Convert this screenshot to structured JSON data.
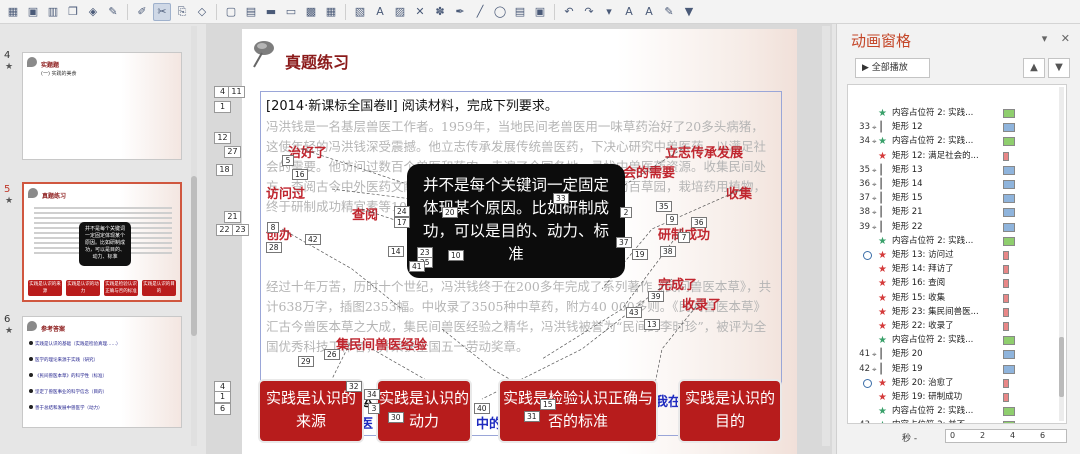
{
  "toolbar": {
    "icons": [
      "layout-icon",
      "picture-icon",
      "chart-icon",
      "group-icon",
      "cube-icon",
      "pin-icon",
      "brush-icon",
      "scissors-icon",
      "copy-icon",
      "shapes-icon",
      "new-icon",
      "open-icon",
      "folder-icon",
      "save-icon",
      "print-icon",
      "table-icon",
      "grid-icon",
      "text-icon",
      "image-icon",
      "erase-icon",
      "symbol-icon",
      "pen-icon",
      "line-icon",
      "shape-icon",
      "layout2-icon",
      "picture2-icon",
      "undo-icon",
      "redo-icon",
      "dropdown-icon",
      "font-up-icon",
      "font-down-icon",
      "highlight-icon",
      "color-icon"
    ]
  },
  "thumbnails": [
    {
      "num": "4",
      "title": "实题题",
      "sub": "(一) 实践的美食"
    },
    {
      "num": "5",
      "title": "真题练习",
      "callout": "并不是每个关键词一定固定体现某个原因。比如研制成功，可以是目的、动力、标准",
      "boxes": [
        "实践是认识的来源",
        "实践是认识的动力",
        "实践是检验认识正确与否的标准",
        "实践是认识的目的"
      ]
    },
    {
      "num": "6",
      "title": "参考答案",
      "items": [
        "实践是认识的基础（实践是检验真理……）",
        "医学的理论来源于实践（研究）",
        "《民间兽医本草》的科学性（标准）",
        "坚定了兽医事业的科学信念（目的）",
        "善于总结和发展中兽医学（动力）"
      ]
    }
  ],
  "slide": {
    "title": "真题练习",
    "intro": "[2014·新课标全国卷Ⅱ] 阅读材料，完成下列要求。",
    "paragraphs": [
      "冯洪钱是一名基层兽医工作者。1959年，当地民间老兽医用一味草药治好了20多头病猪，这使年轻的冯洪钱深受震撼。他立志传承发展传统兽医药，下决心研究中兽医药，以满足社会的需要。他访问过数百个兽医和药农，走遍了全国各地，寻找中兽医药资源。收集民间处方、查阅古今中外医药文献，研究国外最新科技成果，创办中草药百草园，栽培药用植物，终于研制成功精宜素等10多种中草药制剂。",
      "经过十年万苦，历时十个世纪，冯洪钱终于在200多年完成了系列著作《民间兽医本草》，共计638万字，插图2353幅。中收录了3505种中草药，附方40 000多则。《民间兽医本草》汇古今兽医本草之大成，集民间兽医经验之精华，冯洪钱被誉为“民间的李时珍”，被评为全国优秀科技工作者，并荣获全国五一劳动奖章。"
    ],
    "keywords": [
      {
        "text": "治好了",
        "color": "red"
      },
      {
        "text": "立志传承发展",
        "color": "red"
      },
      {
        "text": "满足社会的需要",
        "color": "red"
      },
      {
        "text": "访问过",
        "color": "red"
      },
      {
        "text": "收集",
        "color": "red"
      },
      {
        "text": "查阅",
        "color": "red"
      },
      {
        "text": "创办",
        "color": "red"
      },
      {
        "text": "研制成功",
        "color": "red"
      },
      {
        "text": "完成了",
        "color": "red"
      },
      {
        "text": "收录了",
        "color": "red"
      },
      {
        "text": "集民间兽医经验",
        "color": "red"
      }
    ],
    "callout": "并不是每个关键词一定固定体现某个原因。比如研制成功，可以是目的、动力、标准",
    "answer_boxes": [
      "实践是认识的来源",
      "实践是认识的动力",
      "实践是检验认识正确与否的标准",
      "实践是认识的目的"
    ],
    "hidden_text_fragment_1": "运",
    "hidden_text_fragment_2": "医",
    "hidden_text_fragment_3": "中的",
    "hidden_text_fragment_4": "我在",
    "side_tags": [
      "4",
      "11",
      "1",
      "12",
      "27",
      "18",
      "21",
      "22",
      "23",
      "4",
      "1",
      "6"
    ],
    "tags": [
      "5",
      "16",
      "33",
      "24",
      "17",
      "20",
      "35",
      "9",
      "36",
      "37",
      "19",
      "38",
      "8",
      "28",
      "42",
      "14",
      "23",
      "25",
      "41",
      "10",
      "39",
      "26",
      "29",
      "32",
      "34",
      "3",
      "30",
      "31",
      "15",
      "40",
      "43",
      "13",
      "7",
      "2"
    ]
  },
  "animation_pane": {
    "title": "动画窗格",
    "play_all": "全部播放",
    "rows": [
      {
        "num": "",
        "mouse": false,
        "icon": "star-green",
        "label": "内容占位符 2: 实践...",
        "bar": "green",
        "clock": false
      },
      {
        "num": "33",
        "mouse": true,
        "icon": "bar-blue",
        "label": "矩形 12",
        "bar": "blue",
        "clock": false
      },
      {
        "num": "34",
        "mouse": true,
        "icon": "star-green",
        "label": "内容占位符 2: 实践...",
        "bar": "green",
        "clock": false
      },
      {
        "num": "",
        "mouse": false,
        "icon": "star-red",
        "label": "矩形 12: 满足社会的...",
        "bar": "red",
        "clock": false
      },
      {
        "num": "35",
        "mouse": true,
        "icon": "bar-blue",
        "label": "矩形 13",
        "bar": "blue",
        "clock": false
      },
      {
        "num": "36",
        "mouse": true,
        "icon": "bar-blue",
        "label": "矩形 14",
        "bar": "blue",
        "clock": false
      },
      {
        "num": "37",
        "mouse": true,
        "icon": "bar-blue",
        "label": "矩形 15",
        "bar": "blue",
        "clock": false
      },
      {
        "num": "38",
        "mouse": true,
        "icon": "bar-blue",
        "label": "矩形 21",
        "bar": "blue",
        "clock": false
      },
      {
        "num": "39",
        "mouse": true,
        "icon": "bar-blue",
        "label": "矩形 22",
        "bar": "blue",
        "clock": false
      },
      {
        "num": "",
        "mouse": false,
        "icon": "star-green",
        "label": "内容占位符 2: 实践...",
        "bar": "green",
        "clock": false
      },
      {
        "num": "",
        "mouse": false,
        "icon": "star-red",
        "label": "矩形 13: 访问过",
        "bar": "red",
        "clock": true
      },
      {
        "num": "",
        "mouse": false,
        "icon": "star-red",
        "label": "矩形 14: 拜访了",
        "bar": "red",
        "clock": false
      },
      {
        "num": "",
        "mouse": false,
        "icon": "star-red",
        "label": "矩形 16: 查阅",
        "bar": "red",
        "clock": false
      },
      {
        "num": "",
        "mouse": false,
        "icon": "star-red",
        "label": "矩形 15: 收集",
        "bar": "red",
        "clock": false
      },
      {
        "num": "",
        "mouse": false,
        "icon": "star-red",
        "label": "矩形 23: 集民间兽医...",
        "bar": "red",
        "clock": false
      },
      {
        "num": "",
        "mouse": false,
        "icon": "star-red",
        "label": "矩形 22: 收录了",
        "bar": "red",
        "clock": false
      },
      {
        "num": "",
        "mouse": false,
        "icon": "star-green",
        "label": "内容占位符 2: 实践...",
        "bar": "green",
        "clock": false
      },
      {
        "num": "41",
        "mouse": true,
        "icon": "bar-blue",
        "label": "矩形 20",
        "bar": "blue",
        "clock": false
      },
      {
        "num": "42",
        "mouse": true,
        "icon": "bar-blue",
        "label": "矩形 19",
        "bar": "blue",
        "clock": false
      },
      {
        "num": "",
        "mouse": false,
        "icon": "star-red",
        "label": "矩形 20: 治愈了",
        "bar": "red",
        "clock": true
      },
      {
        "num": "",
        "mouse": false,
        "icon": "star-red",
        "label": "矩形 19: 研制成功",
        "bar": "red",
        "clock": false
      },
      {
        "num": "",
        "mouse": false,
        "icon": "star-green",
        "label": "内容占位符 2: 实践...",
        "bar": "green",
        "clock": false
      },
      {
        "num": "43",
        "mouse": true,
        "icon": "star-green",
        "label": "内容占位符 2: 并不...",
        "bar": "green",
        "clock": false
      }
    ],
    "timeline": {
      "sec": "秒 -",
      "ticks": [
        "0",
        "2",
        "4",
        "6"
      ]
    },
    "colors": {
      "green": "#8fce6e",
      "blue": "#8fb4dc",
      "red": "#e88787",
      "accent": "#c44628"
    }
  }
}
